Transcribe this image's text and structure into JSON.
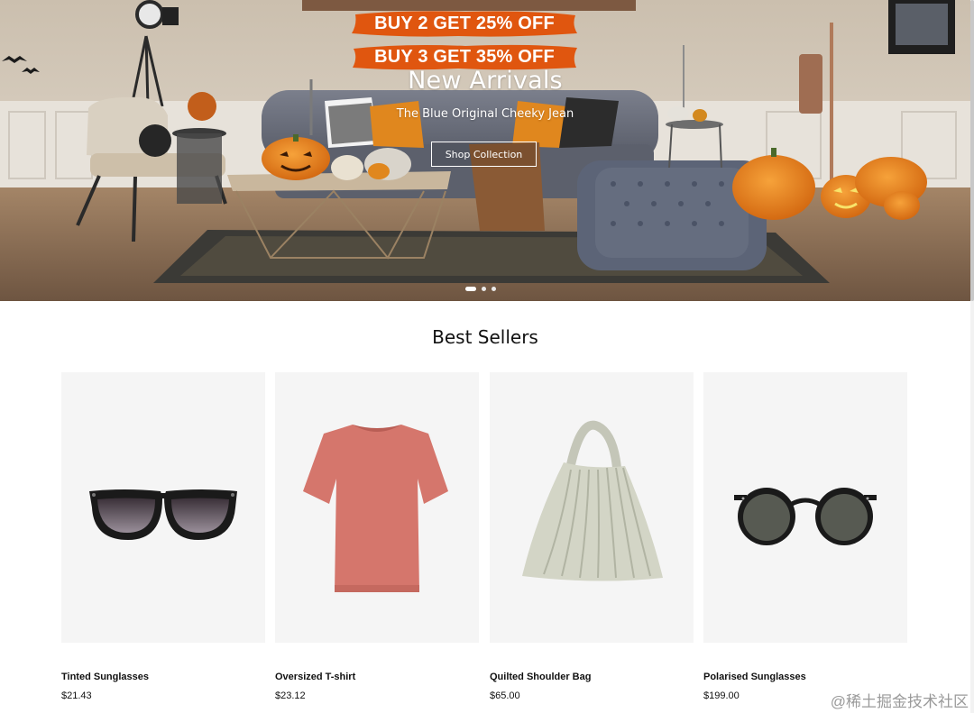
{
  "hero": {
    "promo_line_1": "BUY 2 GET 25% OFF",
    "promo_line_2": "BUY 3 GET 35% OFF",
    "title": "New Arrivals",
    "subtitle": "The Blue Original Cheeky Jean",
    "button_label": "Shop Collection",
    "slides": [
      {
        "active": true
      },
      {
        "active": false
      },
      {
        "active": false
      }
    ],
    "colors": {
      "promo_brush": "#e0560f",
      "text": "#ffffff"
    }
  },
  "best_sellers": {
    "title": "Best Sellers",
    "products": [
      {
        "name": "Tinted Sunglasses",
        "price": "$21.43",
        "image": "tinted-sunglasses-image"
      },
      {
        "name": "Oversized T-shirt",
        "price": "$23.12",
        "image": "pink-tshirt-image"
      },
      {
        "name": "Quilted Shoulder Bag",
        "price": "$65.00",
        "image": "quilted-bag-image"
      },
      {
        "name": "Polarised Sunglasses",
        "price": "$199.00",
        "image": "polarised-sunglasses-image"
      }
    ]
  },
  "watermark": "@稀土掘金技术社区"
}
